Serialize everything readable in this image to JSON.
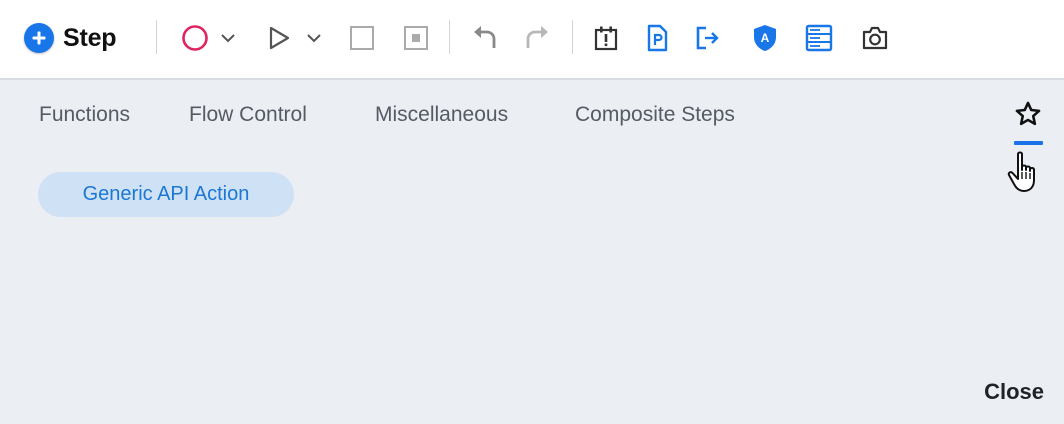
{
  "toolbar": {
    "step_label": "Step",
    "tools": [
      {
        "name": "record-icon",
        "color": "#e0245e"
      },
      {
        "name": "chevron-down-icon"
      },
      {
        "name": "play-icon"
      },
      {
        "name": "chevron-down-icon"
      },
      {
        "name": "stop-icon"
      },
      {
        "name": "pause-record-icon"
      },
      {
        "name": "undo-icon"
      },
      {
        "name": "redo-icon"
      },
      {
        "name": "checkpoint-icon"
      },
      {
        "name": "document-icon",
        "color": "#1976e8"
      },
      {
        "name": "export-icon",
        "color": "#1976e8"
      },
      {
        "name": "shield-icon",
        "color": "#1976e8"
      },
      {
        "name": "data-table-icon",
        "color": "#1976e8"
      },
      {
        "name": "camera-icon"
      }
    ]
  },
  "panel": {
    "tabs": [
      "Functions",
      "Flow Control",
      "Miscellaneous",
      "Composite Steps"
    ],
    "favorites_icon": "star-icon",
    "chips": [
      "Generic API Action"
    ],
    "close_label": "Close"
  },
  "colors": {
    "accent": "#1976e8",
    "record": "#e0245e",
    "panel_bg": "#ebeef3",
    "chip_bg": "#cfe1f4",
    "chip_text": "#1a78d4"
  }
}
